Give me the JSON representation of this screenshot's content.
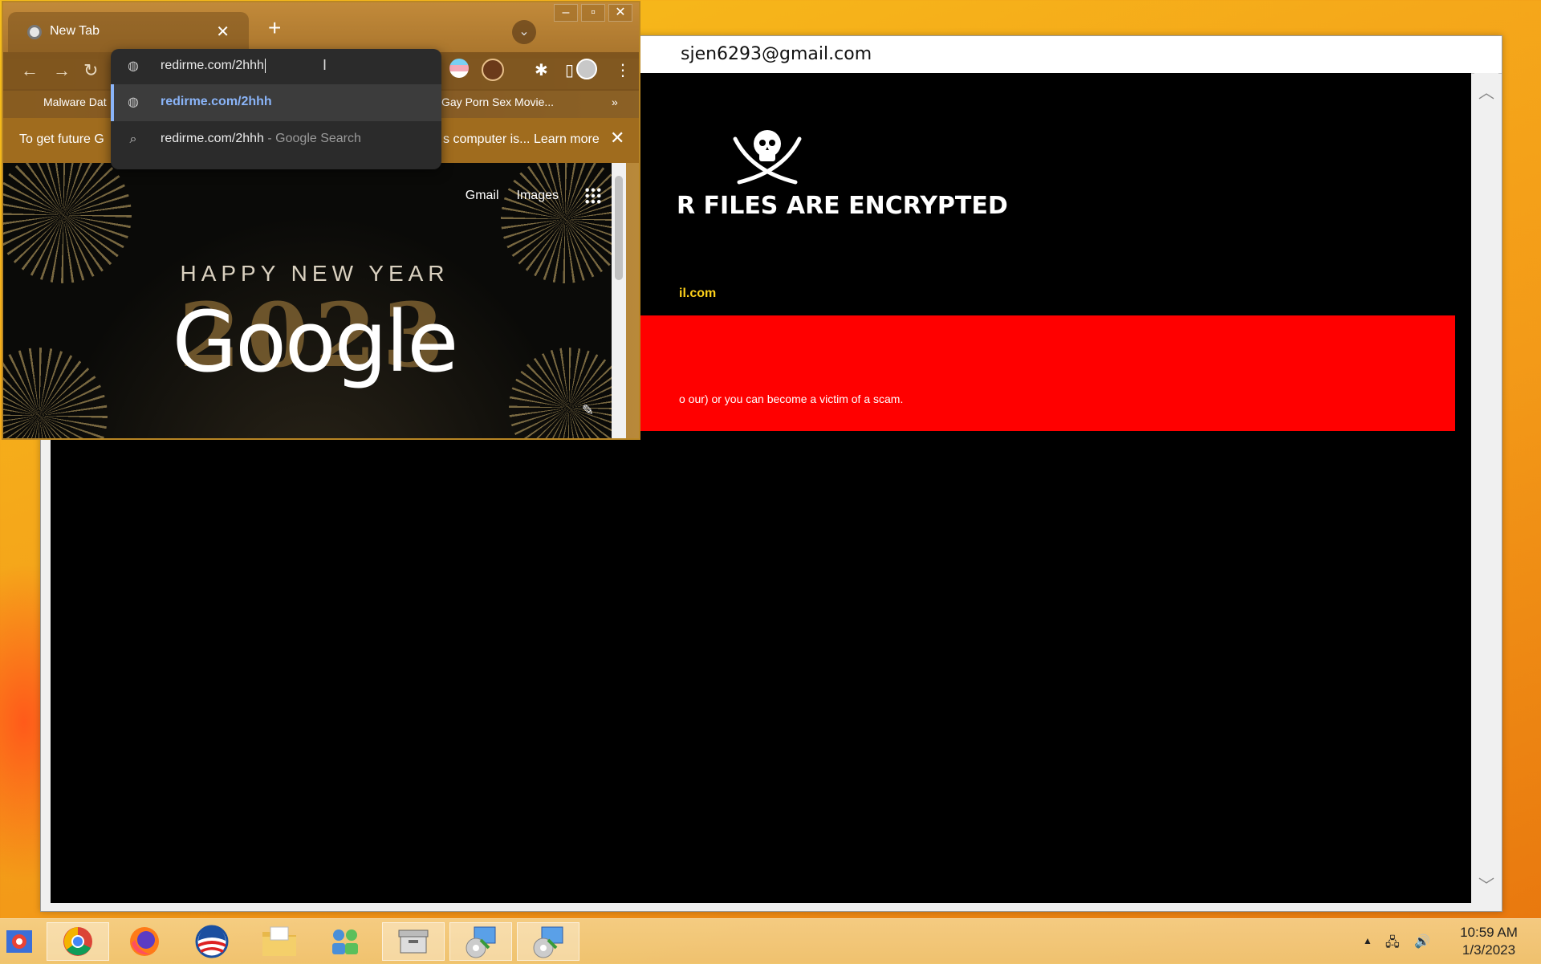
{
  "ransom": {
    "title": "sjen6293@gmail.com",
    "headline": "R FILES ARE ENCRYPTED",
    "email_fragment": "il.com",
    "warning_fragment": "o our) or you can become a victim of a scam."
  },
  "chrome": {
    "tab_title": "New Tab",
    "omnibox": {
      "value": "redirme.com/2hhh",
      "suggestions": [
        {
          "text": "redirme.com/2hhh",
          "suffix": ""
        },
        {
          "text": "redirme.com/2hhh",
          "suffix": " - Google Search"
        }
      ]
    },
    "bookmarks": [
      "Malware Dat",
      "Gay Porn Sex Movie...",
      "»"
    ],
    "infobar": {
      "left_text": "To get future G",
      "right_text": "s computer is...",
      "link": "Learn more"
    },
    "ntp": {
      "links": [
        "Gmail",
        "Images"
      ],
      "doodle_line1": "HAPPY NEW YEAR",
      "doodle_year": "2023",
      "logo": "Google"
    }
  },
  "taskbar": {
    "apps": [
      "chrome-os-icon",
      "chrome-icon",
      "firefox-icon",
      "obama-icon",
      "explorer-icon",
      "network-app-icon",
      "archive-icon",
      "installer-icon",
      "installer-icon"
    ],
    "time": "10:59 AM",
    "date": "1/3/2023"
  }
}
